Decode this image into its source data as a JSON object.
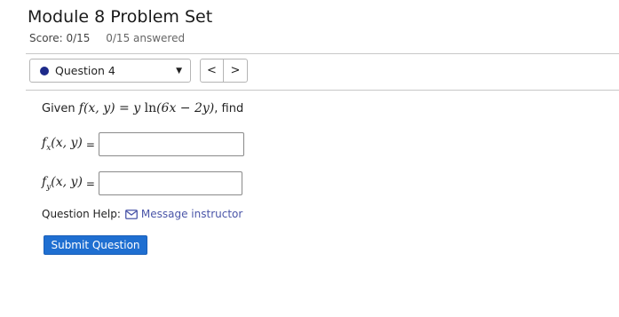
{
  "header": {
    "title": "Module 8 Problem Set",
    "score": "Score: 0/15",
    "answered": "0/15 answered"
  },
  "question_nav": {
    "selected": "Question 4",
    "status_color": "#1d2a8a",
    "prev_label": "<",
    "next_label": ">"
  },
  "question": {
    "prompt_prefix": "Given ",
    "func_name": "f",
    "func_args": "(x, y)",
    "equals": " = ",
    "expr_y": "y",
    "expr_ln": "ln",
    "expr_inner": "(6x − 2y)",
    "prompt_suffix": ", find",
    "fields": [
      {
        "name": "f",
        "sub": "x",
        "args": "(x, y)",
        "eq": "=",
        "value": ""
      },
      {
        "name": "f",
        "sub": "y",
        "args": "(x, y)",
        "eq": "=",
        "value": ""
      }
    ]
  },
  "help": {
    "label": "Question Help:",
    "link": "Message instructor"
  },
  "actions": {
    "submit_label": "Submit Question"
  }
}
